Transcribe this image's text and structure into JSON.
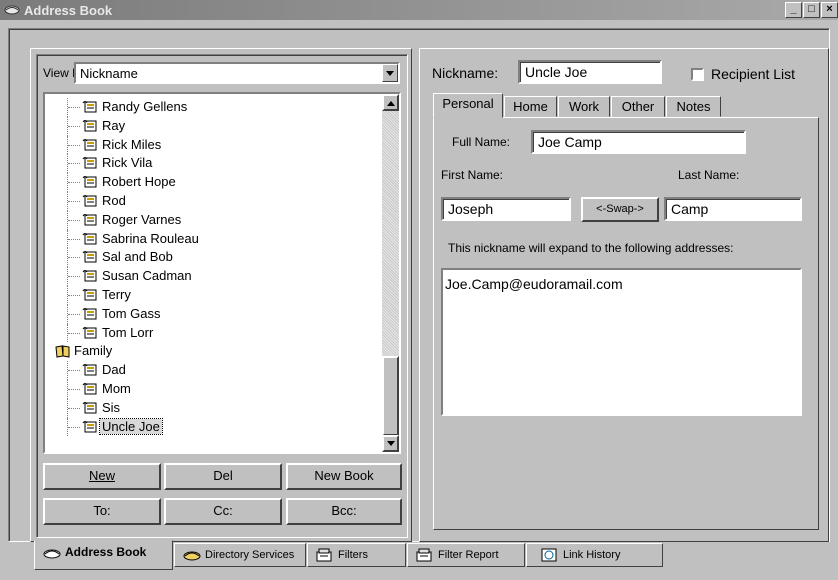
{
  "window": {
    "title": "Address Book",
    "controls": [
      "_",
      "□",
      "×"
    ]
  },
  "left": {
    "view_by_label": "View By:",
    "view_by_value": "Nickname",
    "tree": [
      {
        "label": "Randy Gellens",
        "type": "entry"
      },
      {
        "label": "Ray",
        "type": "entry"
      },
      {
        "label": "Rick Miles",
        "type": "entry"
      },
      {
        "label": "Rick Vila",
        "type": "entry"
      },
      {
        "label": "Robert Hope",
        "type": "entry"
      },
      {
        "label": "Rod",
        "type": "entry"
      },
      {
        "label": "Roger Varnes",
        "type": "entry"
      },
      {
        "label": "Sabrina Rouleau",
        "type": "entry"
      },
      {
        "label": "Sal and Bob",
        "type": "entry"
      },
      {
        "label": "Susan Cadman",
        "type": "entry"
      },
      {
        "label": "Terry",
        "type": "entry"
      },
      {
        "label": "Tom Gass",
        "type": "entry"
      },
      {
        "label": "Tom Lorr",
        "type": "entry"
      },
      {
        "label": "Family",
        "type": "group"
      },
      {
        "label": "Dad",
        "type": "entry"
      },
      {
        "label": "Mom",
        "type": "entry"
      },
      {
        "label": "Sis",
        "type": "entry"
      },
      {
        "label": "Uncle Joe",
        "type": "entry",
        "selected": true
      }
    ],
    "buttons": {
      "new": "New",
      "del": "Del",
      "new_book": "New Book",
      "to": "To:",
      "cc": "Cc:",
      "bcc": "Bcc:"
    }
  },
  "right": {
    "nickname_label": "Nickname:",
    "nickname_value": "Uncle Joe",
    "recipient_list_label": "Recipient List",
    "tabs": [
      "Personal",
      "Home",
      "Work",
      "Other",
      "Notes"
    ],
    "active_tab": "Personal",
    "full_name_label": "Full Name:",
    "full_name_value": "Joe Camp",
    "first_name_label": "First Name:",
    "first_name_value": "Joseph",
    "last_name_label": "Last Name:",
    "last_name_value": "Camp",
    "swap_label": "<-Swap->",
    "expand_text": "This nickname will expand to the following addresses:",
    "addresses": "Joe.Camp@eudoramail.com"
  },
  "bottom_tabs": [
    "Address Book",
    "Directory Services",
    "Filters",
    "Filter Report",
    "Link History"
  ],
  "colors": {
    "face": "#c0c0c0",
    "title_bar": "#7b7b7b",
    "selection": "#d8d8d8"
  }
}
